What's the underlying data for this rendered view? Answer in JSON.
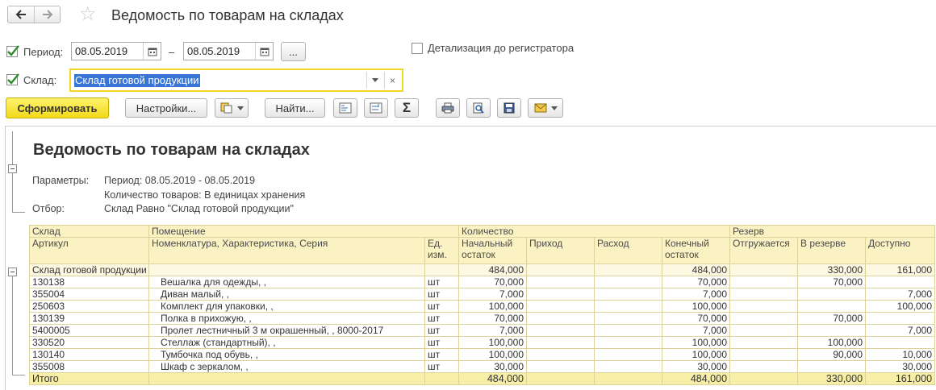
{
  "window": {
    "title": "Ведомость по товарам на складах"
  },
  "form": {
    "period_label": "Период:",
    "date_from": "08.05.2019",
    "dash": "–",
    "date_to": "08.05.2019",
    "choose_label": "...",
    "detail_label": "Детализация до регистратора",
    "sklad_label": "Склад:",
    "sklad_value": "Склад готовой продукции",
    "clear_glyph": "×"
  },
  "toolbar": {
    "generate": "Сформировать",
    "settings": "Настройки...",
    "find": "Найти...",
    "sum_glyph": "Σ"
  },
  "report": {
    "title": "Ведомость по товарам на складах",
    "params_label": "Параметры:",
    "param_period": "Период: 08.05.2019 - 08.05.2019",
    "param_qty": "Количество товаров: В единицах хранения",
    "filter_label": "Отбор:",
    "filter_value": "Склад Равно \"Склад готовой продукции\""
  },
  "table": {
    "h_sklad": "Склад",
    "h_room": "Помещение",
    "h_qty": "Количество",
    "h_reserve": "Резерв",
    "h_article": "Артикул",
    "h_nomen": "Номенклатура, Характеристика, Серия",
    "h_unit": "Ед. изм.",
    "h_start": "Начальный остаток",
    "h_in": "Приход",
    "h_out": "Расход",
    "h_end": "Конечный остаток",
    "h_ship": "Отгружается",
    "h_inres": "В резерве",
    "h_avail": "Доступно",
    "group": {
      "name": "Склад готовой продукции",
      "start": "484,000",
      "end": "484,000",
      "inres": "330,000",
      "avail": "161,000"
    },
    "rows": [
      {
        "article": "130138",
        "name": "Вешалка для одежды, ,",
        "unit": "шт",
        "start": "70,000",
        "end": "70,000",
        "inres": "70,000",
        "avail": ""
      },
      {
        "article": "355004",
        "name": "Диван малый, ,",
        "unit": "шт",
        "start": "7,000",
        "end": "7,000",
        "inres": "",
        "avail": "7,000"
      },
      {
        "article": "250603",
        "name": "Комплект для упаковки, ,",
        "unit": "шт",
        "start": "100,000",
        "end": "100,000",
        "inres": "",
        "avail": "100,000"
      },
      {
        "article": "130139",
        "name": "Полка в прихожую, ,",
        "unit": "шт",
        "start": "70,000",
        "end": "70,000",
        "inres": "70,000",
        "avail": ""
      },
      {
        "article": "5400005",
        "name": "Пролет лестничный 3 м окрашенный, , 8000-2017",
        "unit": "шт",
        "start": "7,000",
        "end": "7,000",
        "inres": "",
        "avail": "7,000"
      },
      {
        "article": "330520",
        "name": "Стеллаж (стандартный), ,",
        "unit": "шт",
        "start": "100,000",
        "end": "100,000",
        "inres": "100,000",
        "avail": ""
      },
      {
        "article": "130140",
        "name": "Тумбочка под обувь, ,",
        "unit": "шт",
        "start": "100,000",
        "end": "100,000",
        "inres": "90,000",
        "avail": "10,000"
      },
      {
        "article": "355008",
        "name": "Шкаф с зеркалом, ,",
        "unit": "шт",
        "start": "30,000",
        "end": "30,000",
        "inres": "",
        "avail": "30,000"
      }
    ],
    "total": {
      "label": "Итого",
      "start": "484,000",
      "end": "484,000",
      "inres": "330,000",
      "avail": "161,000"
    }
  }
}
